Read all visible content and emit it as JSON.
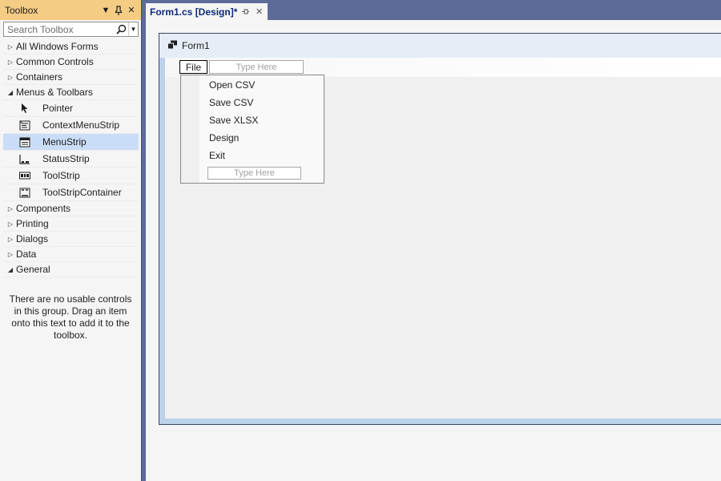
{
  "toolbox": {
    "title": "Toolbox",
    "search_placeholder": "Search Toolbox",
    "categories_top": [
      "All Windows Forms",
      "Common Controls",
      "Containers"
    ],
    "menus_toolbars": {
      "label": "Menus & Toolbars",
      "items": [
        "Pointer",
        "ContextMenuStrip",
        "MenuStrip",
        "StatusStrip",
        "ToolStrip",
        "ToolStripContainer"
      ]
    },
    "categories_bottom": [
      "Components",
      "Printing",
      "Dialogs",
      "Data"
    ],
    "general": "General",
    "empty_message": "There are no usable controls in this group. Drag an item onto this text to add it to the toolbox."
  },
  "document": {
    "tab_label": "Form1.cs [Design]*"
  },
  "form": {
    "title": "Form1",
    "menu": {
      "file": "File",
      "type_here": "Type Here",
      "dropdown_items": [
        "Open CSV",
        "Save CSV",
        "Save XLSX",
        "Design",
        "Exit"
      ],
      "dropdown_type_here": "Type Here"
    }
  }
}
